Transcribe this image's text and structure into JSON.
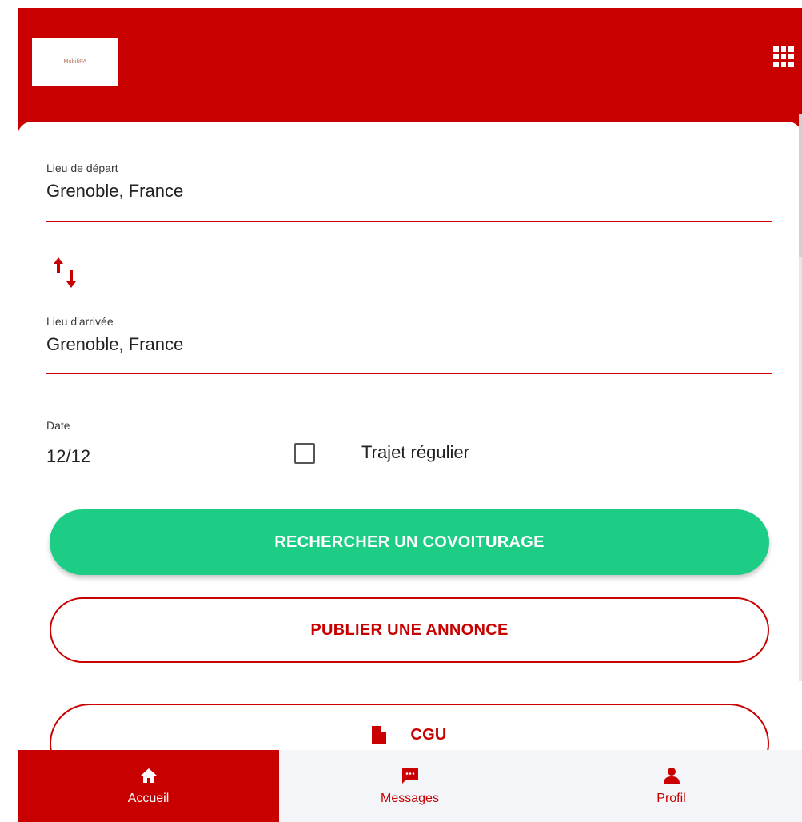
{
  "header": {
    "logo_text": "MobiliPA",
    "apps_icon": "grid-apps-icon"
  },
  "search": {
    "departure_label": "Lieu de départ",
    "departure_value": "Grenoble, France",
    "swap_icon": "swap-vertical-icon",
    "arrival_label": "Lieu d'arrivée",
    "arrival_value": "Grenoble, France",
    "date_label": "Date",
    "date_value": "12/12",
    "regular_label": "Trajet régulier",
    "regular_checked": false
  },
  "actions": {
    "search_button": "RECHERCHER UN COVOITURAGE",
    "publish_button": "PUBLIER UNE ANNONCE",
    "cgu_button": "CGU",
    "cgu_icon": "document-icon"
  },
  "nav": {
    "items": [
      {
        "label": "Accueil",
        "icon": "home-icon",
        "active": true
      },
      {
        "label": "Messages",
        "icon": "message-icon",
        "active": false
      },
      {
        "label": "Profil",
        "icon": "person-icon",
        "active": false
      }
    ]
  },
  "colors": {
    "brand": "#c80000",
    "primary_button": "#1dcc85",
    "nav_background": "#f3f5f8"
  }
}
